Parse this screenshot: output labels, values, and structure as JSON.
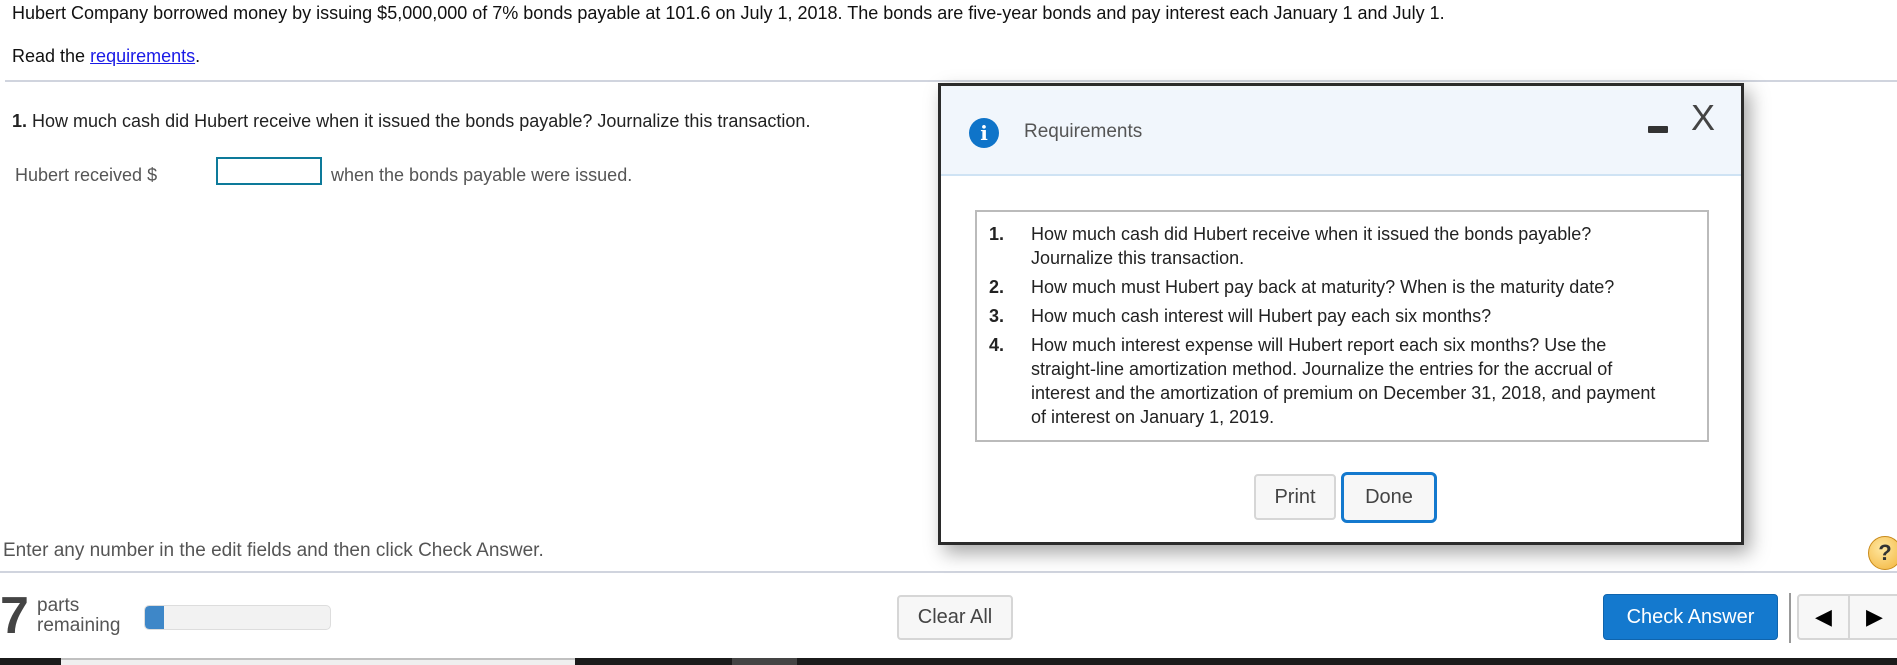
{
  "problem": {
    "intro": "Hubert Company borrowed money by issuing $5,000,000 of 7% bonds payable at 101.6 on July 1, 2018. The bonds are five-year bonds and pay interest each January 1 and July 1.",
    "read_prefix": "Read the ",
    "read_link": "requirements",
    "read_suffix": "."
  },
  "question": {
    "number": "1.",
    "text": " How much cash did Hubert receive when it issued the bonds payable? Journalize this transaction.",
    "received_label": "Hubert received $",
    "received_value": "",
    "received_suffix": "when the bonds payable were issued."
  },
  "footer": {
    "hint": "Enter any number in the edit fields and then click Check Answer.",
    "help_icon": "?",
    "parts_count": "7",
    "parts_label_1": "parts",
    "parts_label_2": "remaining",
    "progress_fraction": 0.1,
    "clear_all": "Clear All",
    "check_answer": "Check Answer",
    "prev_icon": "◀",
    "next_icon": "▶"
  },
  "modal": {
    "info_icon": "i",
    "title": "Requirements",
    "close_icon": "X",
    "requirements": [
      {
        "num": "1.",
        "text": "How much cash did Hubert receive when it issued the bonds payable? Journalize this transaction."
      },
      {
        "num": "2.",
        "text": "How much must Hubert pay back at maturity? When is the maturity date?"
      },
      {
        "num": "3.",
        "text": "How much cash interest will Hubert pay each six months?"
      },
      {
        "num": "4.",
        "text": "How much interest expense will Hubert report each six months? Use the straight-line amortization method. Journalize the entries for the accrual of interest and the amortization of premium on December 31, 2018, and payment of interest on January 1, 2019."
      }
    ],
    "print": "Print",
    "done": "Done"
  }
}
